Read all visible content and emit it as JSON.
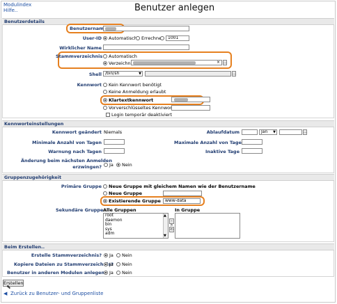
{
  "header": {
    "module_index": "Modulindex",
    "help": "Hilfe..",
    "title": "Benutzer anlegen"
  },
  "sections": {
    "user_details": "Benutzerdetails",
    "password_settings": "Kennworteinstellungen",
    "group_membership": "Gruppenzugehörigkeit",
    "on_create": "Beim Erstellen.."
  },
  "details": {
    "username_label": "Benutzername",
    "userid_label": "User-ID",
    "userid_auto": "Automatisch",
    "userid_calc": "Errechnet",
    "userid_value": "1001",
    "realname_label": "Wirklicher Name",
    "home_label": "Stammverzeichnis",
    "home_auto": "Automatisch",
    "home_dir": "Verzeichnis",
    "shell_label": "Shell",
    "shell_value": "/bin/sh",
    "password_label": "Kennwort",
    "pw_none": "Kein Kennwort benötigt",
    "pw_nologin": "Keine Anmeldung erlaubt",
    "pw_plain": "Klartextkennwort",
    "pw_encrypted": "Vorverschlüsseltes Kennwort",
    "pw_temp_disabled": "Login temporär deaktiviert"
  },
  "password_settings": {
    "changed_label": "Kennwort geändert",
    "changed_value": "Niemals",
    "expiry_label": "Ablaufdatum",
    "expiry_month": "Jan",
    "min_days_label": "Minimale Anzahl von Tagen",
    "max_days_label": "Maximale Anzahl von Tagen",
    "warn_days_label": "Warnung nach Tagen",
    "inactive_days_label": "Inaktive Tage",
    "force_change_label_1": "Änderung beim nächsten Anmelden",
    "force_change_label_2": "erzwingen?",
    "yes": "Ja",
    "no": "Nein"
  },
  "groups": {
    "primary_label": "Primäre Gruppe",
    "opt_same_name": "Neue Gruppe mit gleichem Namen wie der Benutzername",
    "opt_new": "Neue Gruppe",
    "opt_existing": "Existierende Gruppe",
    "existing_value": "www-data",
    "secondary_label": "Sekundäre Gruppe",
    "all_groups_label": "Alle Gruppen",
    "in_group_label": "In Gruppe",
    "all_groups": [
      "root",
      "daemon",
      "bin",
      "sys",
      "adm"
    ],
    "move_right": "->",
    "move_left": "<-"
  },
  "on_create": {
    "create_home_label": "Erstelle Stammverzeichnis?",
    "copy_files_label": "Kopiere Dateien zu Stammverzeichnis?",
    "other_modules_label": "Benutzer in anderen Modulen anlegen?",
    "yes": "Ja",
    "no": "Nein"
  },
  "footer": {
    "create_button": "Erstellen",
    "back_link": "Zurück zu Benutzer- und Gruppenliste"
  },
  "colors": {
    "highlight": "#e6801f",
    "label_blue": "#1f3b70",
    "link_blue": "#1d4fa3"
  }
}
